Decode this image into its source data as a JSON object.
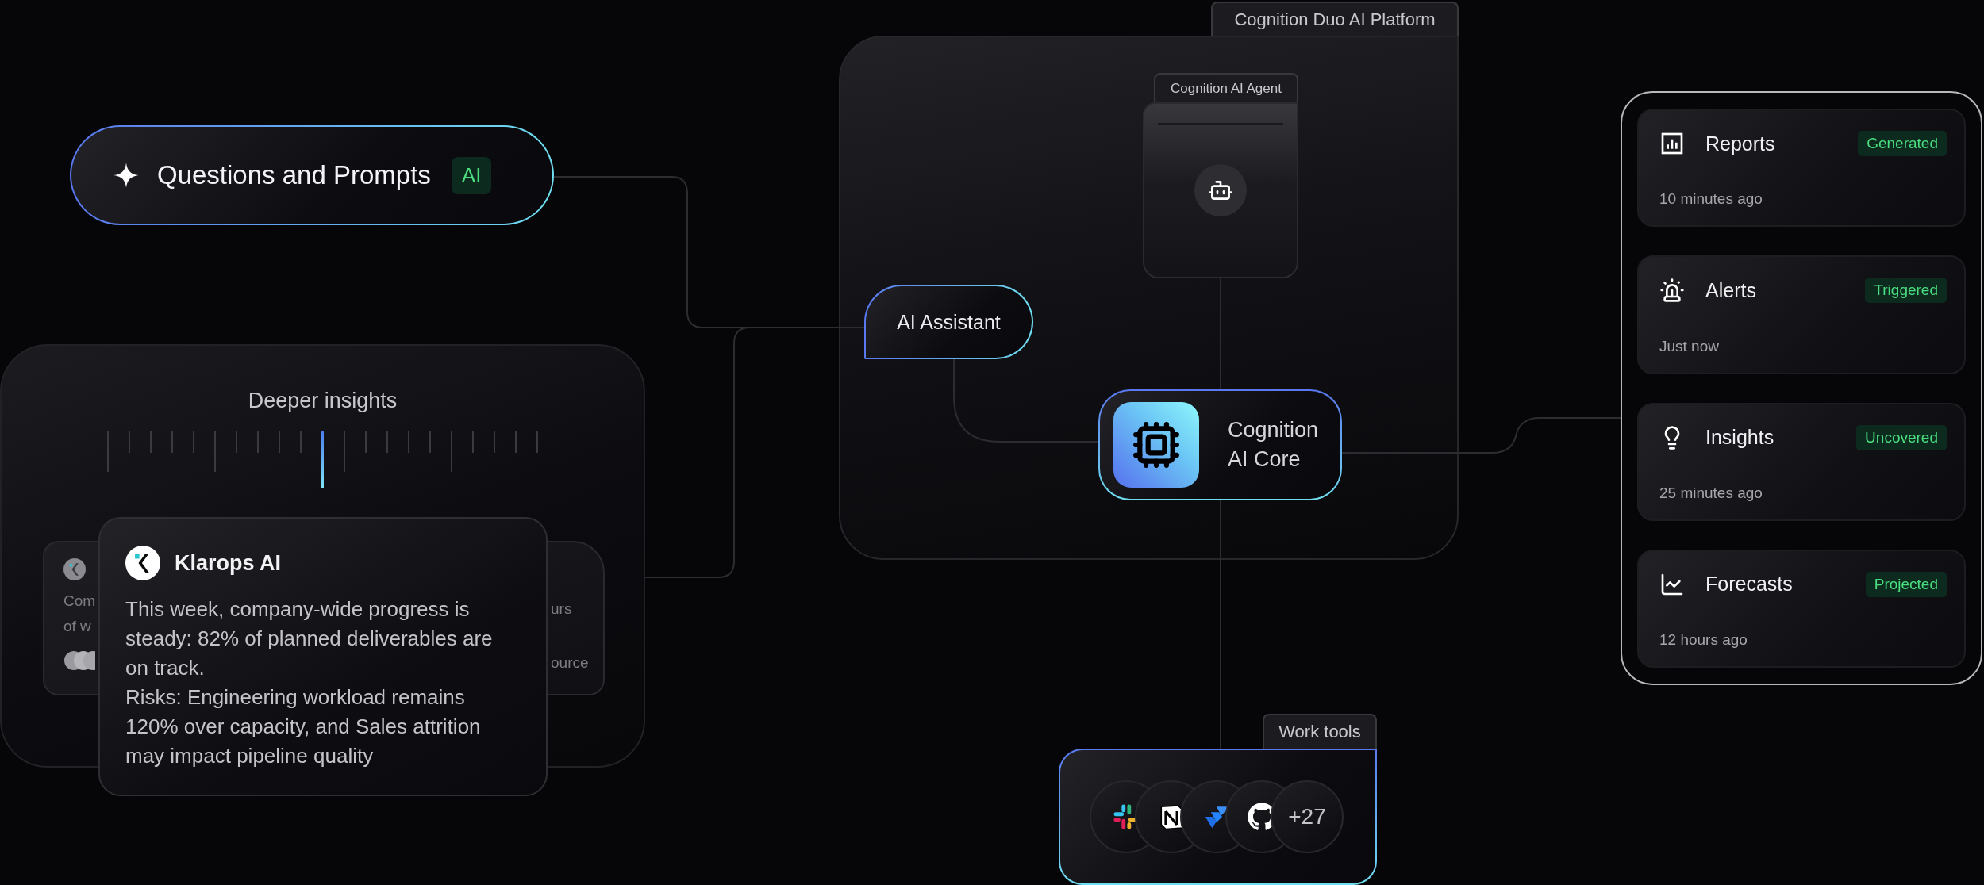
{
  "prompt": {
    "label": "Questions and Prompts",
    "badge": "AI"
  },
  "insights": {
    "title": "Deeper insights",
    "level": 0.5
  },
  "background_card": {
    "left_fragments": [
      "Com",
      "of w"
    ],
    "right_fragments": [
      "urs",
      "ource"
    ]
  },
  "message": {
    "sender": "Klarops AI",
    "paragraphs": [
      "This week, company-wide progress is steady: 82% of planned deliverables are on track.",
      "Risks: Engineering workload remains 120% over capacity, and Sales attrition may impact pipeline quality"
    ]
  },
  "platform": {
    "title": "Cognition Duo AI Platform",
    "agent": "Cognition AI Agent",
    "assistant": "AI Assistant",
    "core": "Cognition AI Core"
  },
  "outputs": [
    {
      "kind": "reports",
      "title": "Reports",
      "status": "Generated",
      "time": "10 minutes ago"
    },
    {
      "kind": "alerts",
      "title": "Alerts",
      "status": "Triggered",
      "time": "Just now"
    },
    {
      "kind": "insights",
      "title": "Insights",
      "status": "Uncovered",
      "time": "25 minutes ago"
    },
    {
      "kind": "forecasts",
      "title": "Forecasts",
      "status": "Projected",
      "time": "12 hours ago"
    }
  ],
  "work_tools": {
    "title": "Work tools",
    "tools": [
      {
        "kind": "slack"
      },
      {
        "kind": "notion"
      },
      {
        "kind": "jira"
      },
      {
        "kind": "github"
      }
    ],
    "more": "+27"
  }
}
